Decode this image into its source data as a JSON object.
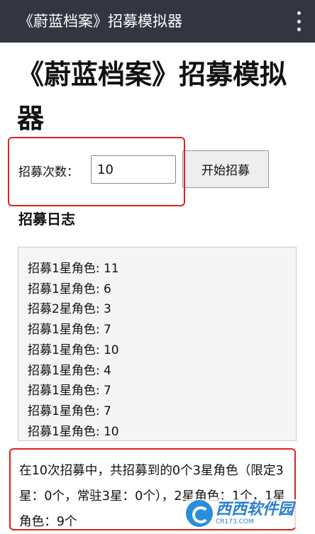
{
  "appbar": {
    "title": "《蔚蓝档案》招募模拟器",
    "menu_icon": "more-vertical-icon"
  },
  "page": {
    "title": "《蔚蓝档案》招募模拟器"
  },
  "form": {
    "count_label": "招募次数：",
    "count_value": "10",
    "start_button": "开始招募"
  },
  "log": {
    "heading": "招募日志",
    "lines": [
      "招募1星角色: 11",
      "招募1星角色: 6",
      "招募2星角色: 3",
      "招募1星角色: 7",
      "招募1星角色: 10",
      "招募1星角色: 4",
      "招募1星角色: 7",
      "招募1星角色: 7",
      "招募1星角色: 10"
    ]
  },
  "summary": {
    "text": "在10次招募中，共招募到的0个3星角色（限定3星：0个，常驻3星：0个），2星角色：1个，1星角色：9个"
  },
  "watermark": {
    "name": "西西软件园",
    "url": "CR173.COM"
  },
  "colors": {
    "appbar": "#333641",
    "highlight": "#e02020",
    "log_bg": "#f5f5f5"
  }
}
